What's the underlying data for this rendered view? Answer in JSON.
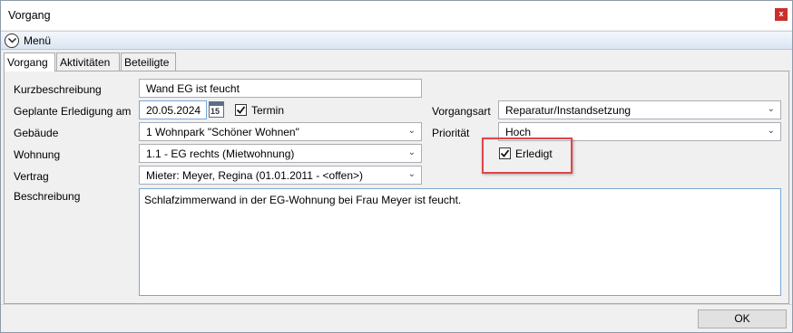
{
  "window": {
    "title": "Vorgang",
    "close_label": "x"
  },
  "menu": {
    "label": "Menü"
  },
  "tabs": [
    {
      "label": "Vorgang",
      "active": true
    },
    {
      "label": "Aktivitäten",
      "active": false
    },
    {
      "label": "Beteiligte",
      "active": false
    }
  ],
  "form": {
    "kurzbeschreibung": {
      "label": "Kurzbeschreibung",
      "value": "Wand EG ist feucht"
    },
    "erledigung": {
      "label": "Geplante Erledigung am",
      "value": "20.05.2024",
      "calendar_day": "15"
    },
    "termin": {
      "label": "Termin",
      "checked": true
    },
    "gebaeude": {
      "label": "Gebäude",
      "value": "1 Wohnpark \"Schöner Wohnen\""
    },
    "wohnung": {
      "label": "Wohnung",
      "value": "1.1 - EG rechts (Mietwohnung)"
    },
    "vertrag": {
      "label": "Vertrag",
      "value": "Mieter: Meyer, Regina (01.01.2011 - <offen>)"
    },
    "beschreibung": {
      "label": "Beschreibung",
      "value": "Schlafzimmerwand in der EG-Wohnung bei Frau Meyer ist feucht."
    },
    "vorgangsart": {
      "label": "Vorgangsart",
      "value": "Reparatur/Instandsetzung"
    },
    "prioritaet": {
      "label": "Priorität",
      "value": "Hoch"
    },
    "erledigt": {
      "label": "Erledigt",
      "checked": true
    }
  },
  "footer": {
    "ok_label": "OK"
  },
  "colors": {
    "highlight": "#e0454a",
    "close": "#c9302c",
    "menu_gradient": "#dbe6f3"
  }
}
